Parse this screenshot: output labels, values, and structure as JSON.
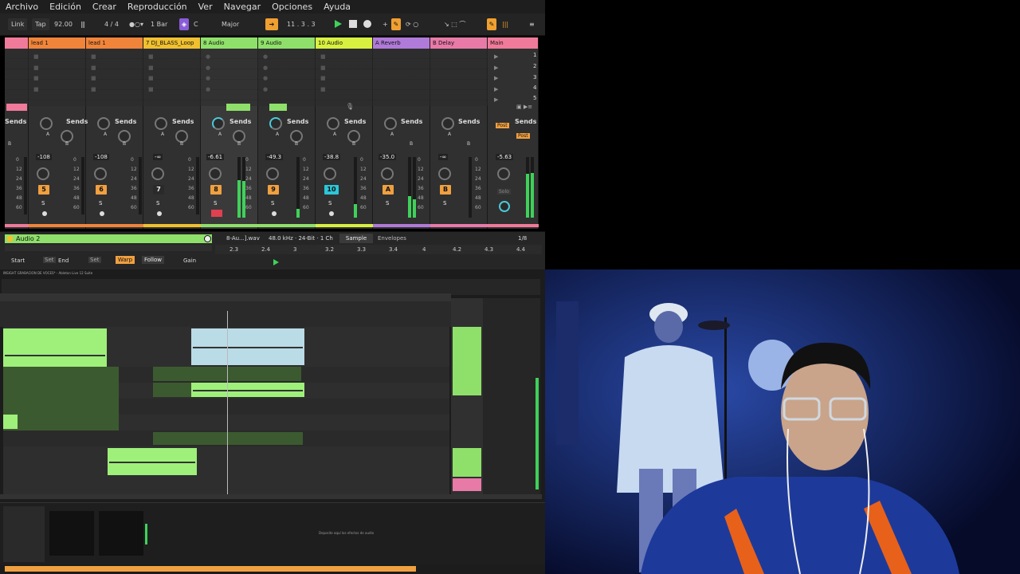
{
  "menu": [
    "Archivo",
    "Edición",
    "Crear",
    "Reproducción",
    "Ver",
    "Navegar",
    "Opciones",
    "Ayuda"
  ],
  "control_bar": {
    "link": "Link",
    "tap": "Tap",
    "tempo": "92.00",
    "time_sig": "4 / 4",
    "quantize": "1 Bar",
    "key": "C",
    "scale": "Major",
    "position": "11 .  3 .  3"
  },
  "tracks": [
    {
      "name": "",
      "color": "#f07a9a",
      "num": "5",
      "vol": "-108",
      "numcolor": "#f0a060"
    },
    {
      "name": "lead 1",
      "color": "#f0843a"
    },
    {
      "name": "lead 1",
      "color": "#f0843a"
    },
    {
      "name": "7 DJ_BLASS_Loop",
      "color": "#f0c030"
    },
    {
      "name": "8 Audio",
      "color": "#8fe06a"
    },
    {
      "name": "9 Audio",
      "color": "#8fe06a"
    },
    {
      "name": "10 Audio",
      "color": "#d8f040"
    },
    {
      "name": "A Reverb",
      "color": "#b07ad8"
    },
    {
      "name": "B Delay",
      "color": "#e87aa8"
    },
    {
      "name": "Main",
      "color": "#f07a9a"
    }
  ],
  "strips": [
    {
      "vol": "-108",
      "num": "5",
      "numcolor": "#f0a040"
    },
    {
      "vol": "-108",
      "num": "6",
      "numcolor": "#f0a040"
    },
    {
      "vol": "-∞",
      "num": "7",
      "numcolor": "#2a2a2a"
    },
    {
      "vol": "-6.61",
      "num": "8",
      "numcolor": "#f0a040"
    },
    {
      "vol": "-49.3",
      "num": "9",
      "numcolor": "#f0a040"
    },
    {
      "vol": "-38.8",
      "num": "10",
      "numcolor": "#2cc6d8"
    },
    {
      "vol": "-35.0",
      "num": "A",
      "numcolor": "#f0a040"
    },
    {
      "vol": "-∞",
      "num": "B",
      "numcolor": "#f0a040"
    },
    {
      "vol": "-5.63",
      "num": "",
      "numcolor": "#303030"
    }
  ],
  "sends_label": "Sends",
  "knob_a": "A",
  "knob_b": "B",
  "solo_label": "S",
  "post_label": "Post",
  "solo_main": "Solo",
  "scene_numbers": [
    "1",
    "2",
    "3",
    "4",
    "5"
  ],
  "meter_scale": [
    "0",
    "12",
    "24",
    "36",
    "48",
    "60"
  ],
  "detail": {
    "clip_name": "Audio 2",
    "file": "8-Au...].wav",
    "format": "48.0 kHz · 24-Bit · 1 Ch",
    "tab_sample": "Sample",
    "tab_envelopes": "Envelopes",
    "start": "Start",
    "set": "Set",
    "end": "End",
    "set2": "Set",
    "warp": "Warp",
    "follow": "Follow",
    "gain": "Gain",
    "quant": "1/8",
    "ruler": [
      "2.3",
      "2.4",
      "3",
      "3.2",
      "3.3",
      "3.4",
      "4",
      "4.2",
      "4.3",
      "4.4"
    ]
  },
  "lower": {
    "title": "INSIGHT GRABACION DE VOCES* - Ableton Live 12 Suite",
    "drop_text": "Deposite aquí los efectos de audio"
  }
}
